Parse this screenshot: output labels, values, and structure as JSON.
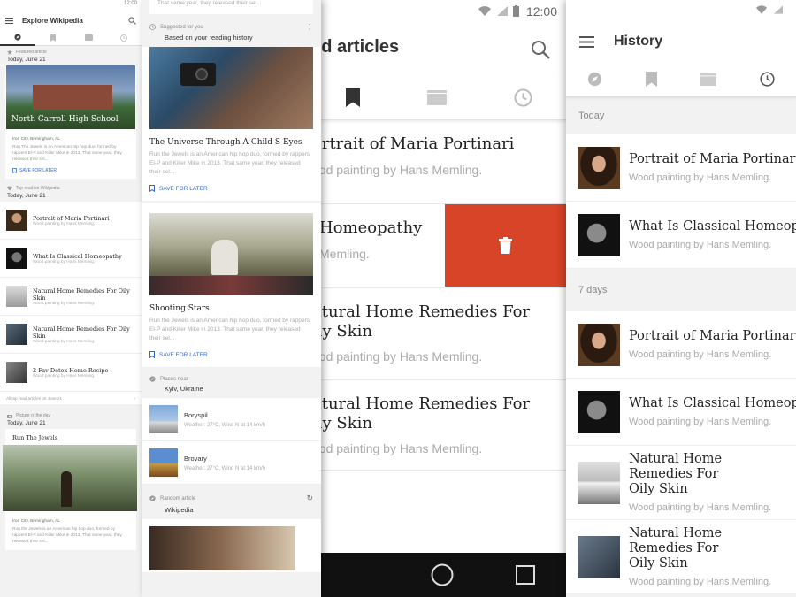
{
  "screen1": {
    "status_time": "12:00",
    "title": "Explore Wikipedia",
    "featured": {
      "label": "Featured article",
      "date": "Today, June 21",
      "image_title": "North Carroll High School",
      "subtitle": "Iron City, Birmingham, AL",
      "text": "Run The Jewels is an American hip hop duo, formed by rappers El-P and Killer Mike in 2013. That same year, they released their sel...",
      "save": "SAVE FOR LATER"
    },
    "topread": {
      "label": "Top read on Wikipedia",
      "date": "Today, June 21",
      "items": [
        {
          "title": "Portrait of Maria Portinari",
          "desc": "Wood painting by Hans Memling."
        },
        {
          "title": "What Is Classical Homeopathy",
          "desc": "Wood painting by Hans Memling."
        },
        {
          "title": "Natural Home Remedies For Oily Skin",
          "desc": "Wood painting by Hans Memling."
        },
        {
          "title": "Natural Home Remedies For Oily Skin",
          "desc": "Wood painting by Hans Memling."
        },
        {
          "title": "2 Fav Detox Home Recipe",
          "desc": "Wood painting by Hans Memling."
        }
      ],
      "all": "All top read articles on June 21"
    },
    "potd": {
      "label": "Picture of the day",
      "date": "Today, June 21",
      "title": "Run The Jewels",
      "subtitle": "Iron City, Birmingham, AL",
      "text": "Run the Jewels is an American hip hop duo, formed by rappers El-P and Killer Mike in 2013. That same year, they released their sel..."
    }
  },
  "screen2": {
    "top_text": "That same year, they released their sel...",
    "suggested": {
      "label": "Suggested for you",
      "sub": "Based on your reading history"
    },
    "cards": [
      {
        "title": "The Universe Through A Child S Eyes",
        "text": "Run the Jewels is an American hip hop duo, formed by rappers El-P and Killer Mike in 2013. That same year, they released their sel...",
        "save": "SAVE FOR LATER"
      },
      {
        "title": "Shooting Stars",
        "text": "Run the Jewels is an American hip hop duo, formed by rappers El-P and Killer Mike in 2013. That same year, they released their sel...",
        "save": "SAVE FOR LATER"
      }
    ],
    "places": {
      "label": "Places near",
      "sub": "Kyiv, Ukraine",
      "items": [
        {
          "title": "Boryspil",
          "desc": "Weather: 27°C, Wind N at 14 km/h"
        },
        {
          "title": "Brovary",
          "desc": "Weather: 27°C, Wind N at 14 km/h"
        }
      ]
    },
    "random": {
      "label": "Random article",
      "sub": "Wikipedia"
    }
  },
  "screen3": {
    "status_time": "12:00",
    "title": "ved articles",
    "items": [
      {
        "title": "ortrait of Maria Portinari",
        "desc": "ood painting by Hans Memling."
      },
      {
        "title": "Homeopathy",
        "desc": "Memling."
      },
      {
        "title": "atural Home Remedies For\nily Skin",
        "desc": "ood painting by Hans Memling."
      },
      {
        "title": "atural Home Remedies For\nily Skin",
        "desc": "ood painting by Hans Memling."
      }
    ]
  },
  "screen4": {
    "title": "History",
    "sections": [
      {
        "label": "Today",
        "items": [
          {
            "title": "Portrait of Maria Portinari",
            "desc": "Wood painting by Hans Memling."
          },
          {
            "title": "What Is Classical Homeopat",
            "desc": "Wood painting by Hans Memling."
          }
        ]
      },
      {
        "label": "7 days",
        "items": [
          {
            "title": "Portrait of Maria Portinari",
            "desc": "Wood painting by Hans Memling."
          },
          {
            "title": "What Is Classical Homeopat",
            "desc": "Wood painting by Hans Memling."
          },
          {
            "title": "Natural Home Remedies For\nOily Skin",
            "desc": "Wood painting by Hans Memling."
          },
          {
            "title": "Natural Home Remedies For\nOily Skin",
            "desc": "Wood painting by Hans Memling."
          }
        ]
      }
    ]
  },
  "colors": {
    "accent": "#3366cc",
    "delete": "#d84427",
    "navbar": "#111111"
  }
}
